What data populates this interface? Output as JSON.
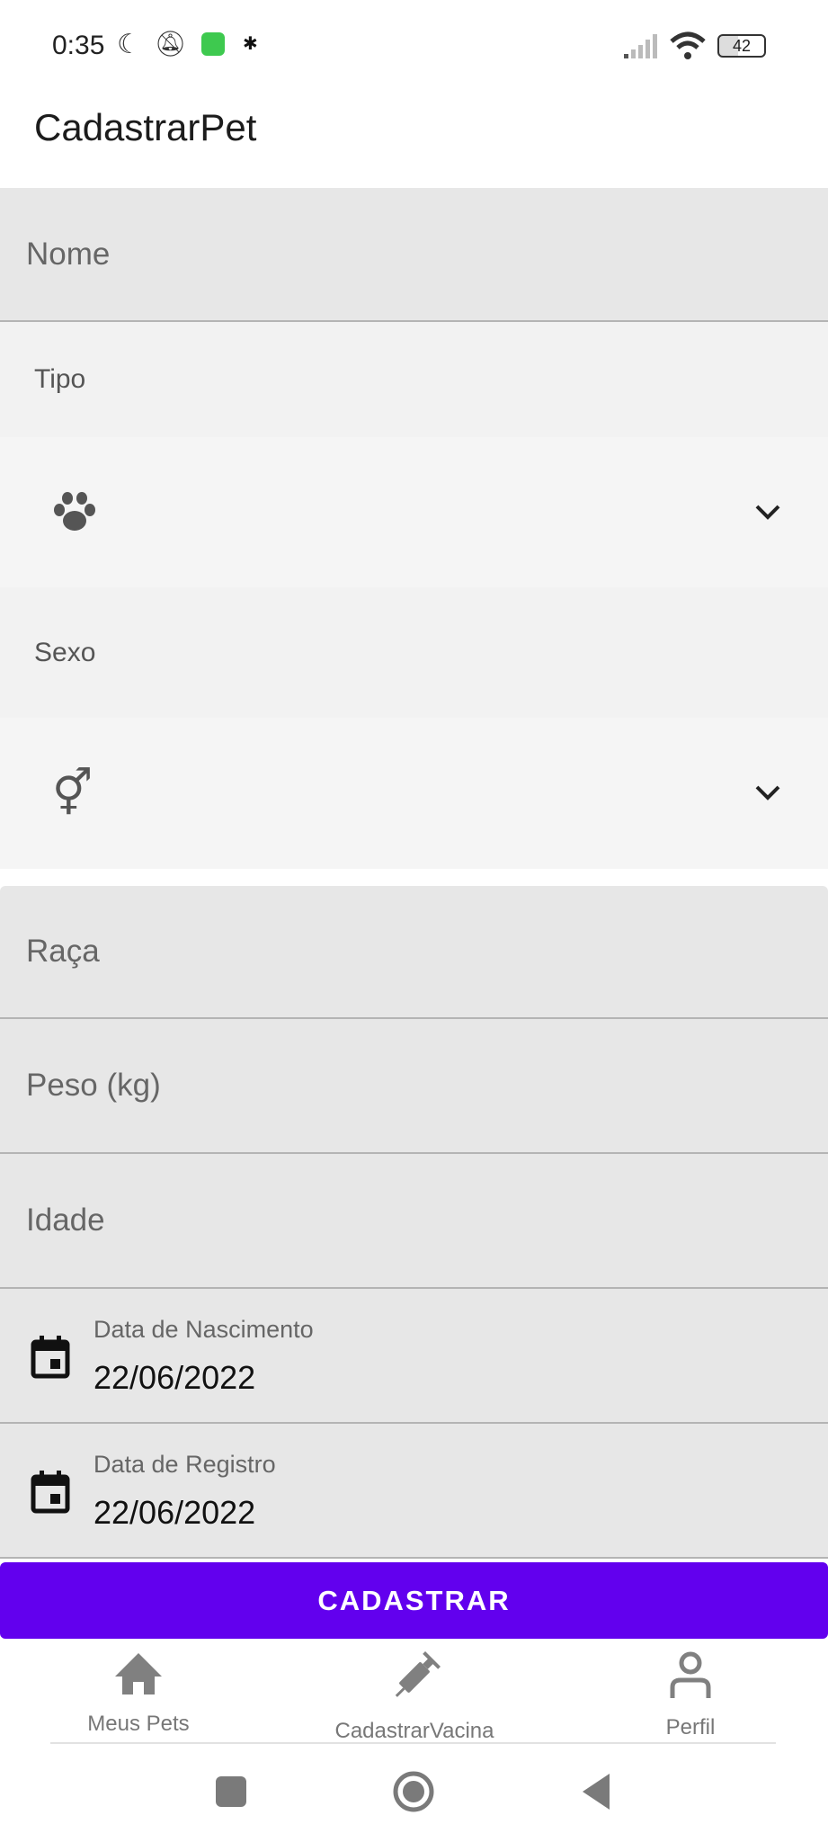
{
  "status_bar": {
    "time": "0:35",
    "battery": "42"
  },
  "header": {
    "title": "CadastrarPet"
  },
  "form": {
    "nome_placeholder": "Nome",
    "tipo_label": "Tipo",
    "tipo_icon": "paw-icon",
    "sexo_label": "Sexo",
    "sexo_icon": "gender-icon",
    "raca_placeholder": "Raça",
    "peso_placeholder": "Peso (kg)",
    "idade_placeholder": "Idade",
    "nascimento_label": "Data de Nascimento",
    "nascimento_value": "22/06/2022",
    "registro_label": "Data de Registro",
    "registro_value": "22/06/2022",
    "submit_label": "CADASTRAR"
  },
  "bottom_nav": {
    "items": [
      {
        "label": "Meus Pets",
        "icon": "home-icon"
      },
      {
        "label": "CadastrarVacina",
        "icon": "syringe-icon"
      },
      {
        "label": "Perfil",
        "icon": "person-icon"
      }
    ]
  },
  "colors": {
    "accent": "#6200ee"
  }
}
